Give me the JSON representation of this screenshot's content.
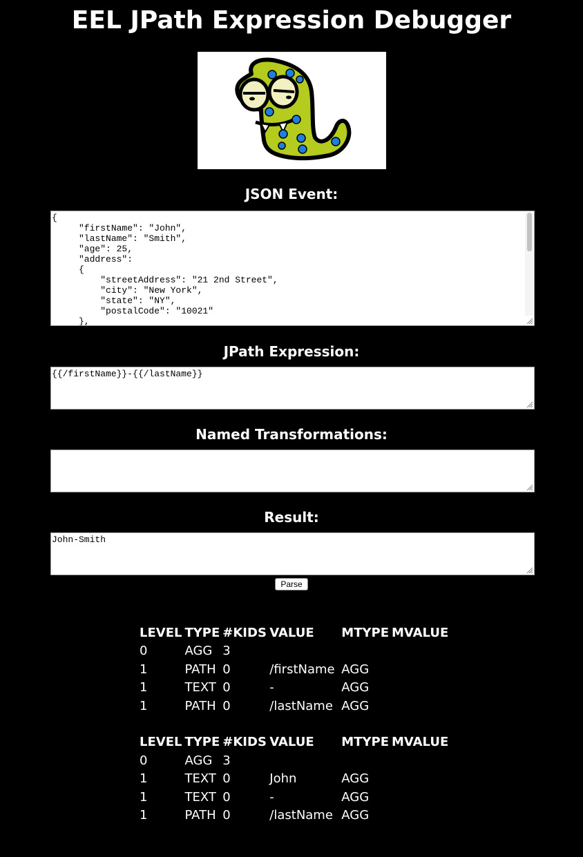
{
  "page": {
    "title": "EEL JPath Expression Debugger"
  },
  "logo": {
    "alt": "EEL monster logo"
  },
  "sections": {
    "json_event": {
      "heading": "JSON Event:",
      "value": "{\n     \"firstName\": \"John\",\n     \"lastName\": \"Smith\",\n     \"age\": 25,\n     \"address\":\n     {\n         \"streetAddress\": \"21 2nd Street\",\n         \"city\": \"New York\",\n         \"state\": \"NY\",\n         \"postalCode\": \"10021\"\n     },"
    },
    "jpath_expression": {
      "heading": "JPath Expression:",
      "value": "{{/firstName}}-{{/lastName}}"
    },
    "named_transformations": {
      "heading": "Named Transformations:",
      "value": ""
    },
    "result": {
      "heading": "Result:",
      "value": "John-Smith"
    }
  },
  "parse_button": {
    "label": "Parse"
  },
  "ast_tables": [
    {
      "headers": [
        "LEVEL",
        "TYPE",
        "#KIDS",
        "VALUE",
        "MTYPE",
        "MVALUE"
      ],
      "rows": [
        [
          "0",
          "AGG",
          "3",
          "",
          "",
          ""
        ],
        [
          "1",
          "PATH",
          "0",
          "/firstName",
          "AGG",
          ""
        ],
        [
          "1",
          "TEXT",
          "0",
          "-",
          "AGG",
          ""
        ],
        [
          "1",
          "PATH",
          "0",
          "/lastName",
          "AGG",
          ""
        ]
      ]
    },
    {
      "headers": [
        "LEVEL",
        "TYPE",
        "#KIDS",
        "VALUE",
        "MTYPE",
        "MVALUE"
      ],
      "rows": [
        [
          "0",
          "AGG",
          "3",
          "",
          "",
          ""
        ],
        [
          "1",
          "TEXT",
          "0",
          "John",
          "AGG",
          ""
        ],
        [
          "1",
          "TEXT",
          "0",
          "-",
          "AGG",
          ""
        ],
        [
          "1",
          "PATH",
          "0",
          "/lastName",
          "AGG",
          ""
        ]
      ]
    }
  ],
  "colors": {
    "background": "#000000",
    "text": "#ffffff",
    "monster_body": "#b5cc1e",
    "monster_spots": "#1e7fe0",
    "monster_eyes": "#f2efc0"
  },
  "icons": {
    "resize_grip": "resize-grip-icon",
    "logo": "monster-logo-icon"
  }
}
